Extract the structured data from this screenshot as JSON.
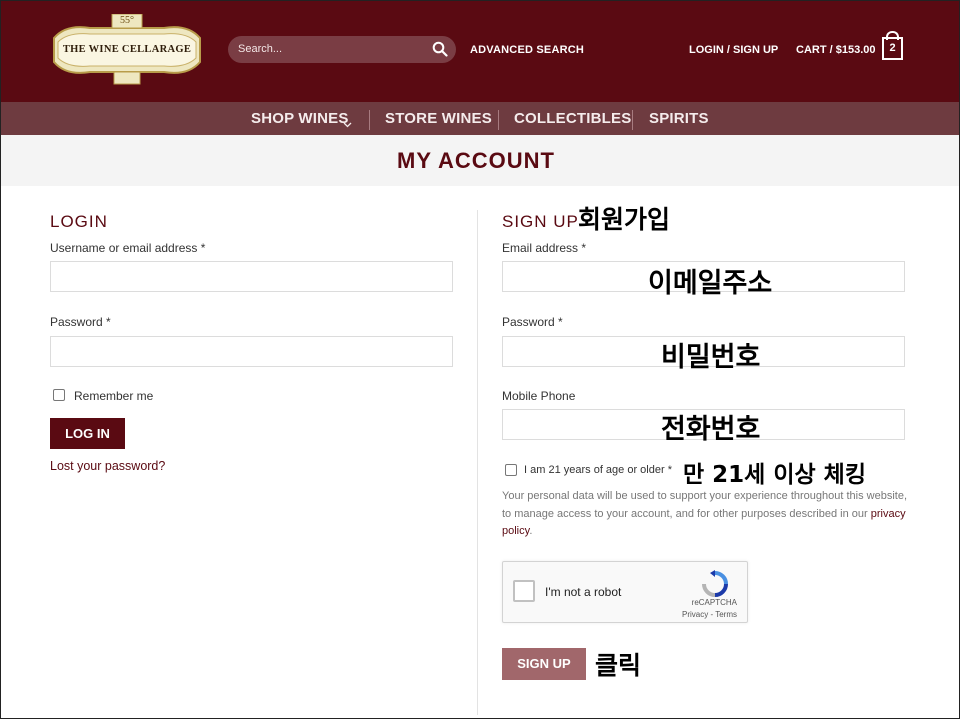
{
  "header": {
    "logo": {
      "text": "THE WINE CELLARAGE",
      "degree": "55°"
    },
    "search": {
      "placeholder": "Search..."
    },
    "advanced_search": "ADVANCED SEARCH",
    "login_signup": "LOGIN / SIGN UP",
    "cart": "CART / $153.00",
    "cart_count": "2"
  },
  "nav": {
    "items": [
      "SHOP WINES",
      "STORE WINES",
      "COLLECTIBLES",
      "SPIRITS"
    ]
  },
  "page_title": "MY ACCOUNT",
  "login": {
    "heading": "LOGIN",
    "username_label": "Username or email address *",
    "password_label": "Password *",
    "remember_label": "Remember me",
    "button": "LOG IN",
    "lost_password": "Lost your password?"
  },
  "signup": {
    "heading": "SIGN UP",
    "email_label": "Email address *",
    "password_label": "Password *",
    "phone_label": "Mobile Phone",
    "age_label": "I am 21 years of age or older *",
    "privacy_text": "Your personal data will be used to support your experience throughout this website, to manage access to your account, and for other purposes described in our",
    "privacy_link": "privacy policy",
    "privacy_end": ".",
    "captcha_text": "I'm not a robot",
    "captcha_brand": "reCAPTCHA",
    "captcha_terms": "Privacy - Terms",
    "button": "SIGN UP"
  },
  "annotations": {
    "signup": "회원가입",
    "email": "이메일주소",
    "password": "비밀번호",
    "phone": "전화번호",
    "age": "만 21세 이상 체킹",
    "click": "클릭"
  },
  "colors": {
    "brand": "#5a0a12",
    "nav": "#6e3b40",
    "signup_button": "#a1676b"
  }
}
